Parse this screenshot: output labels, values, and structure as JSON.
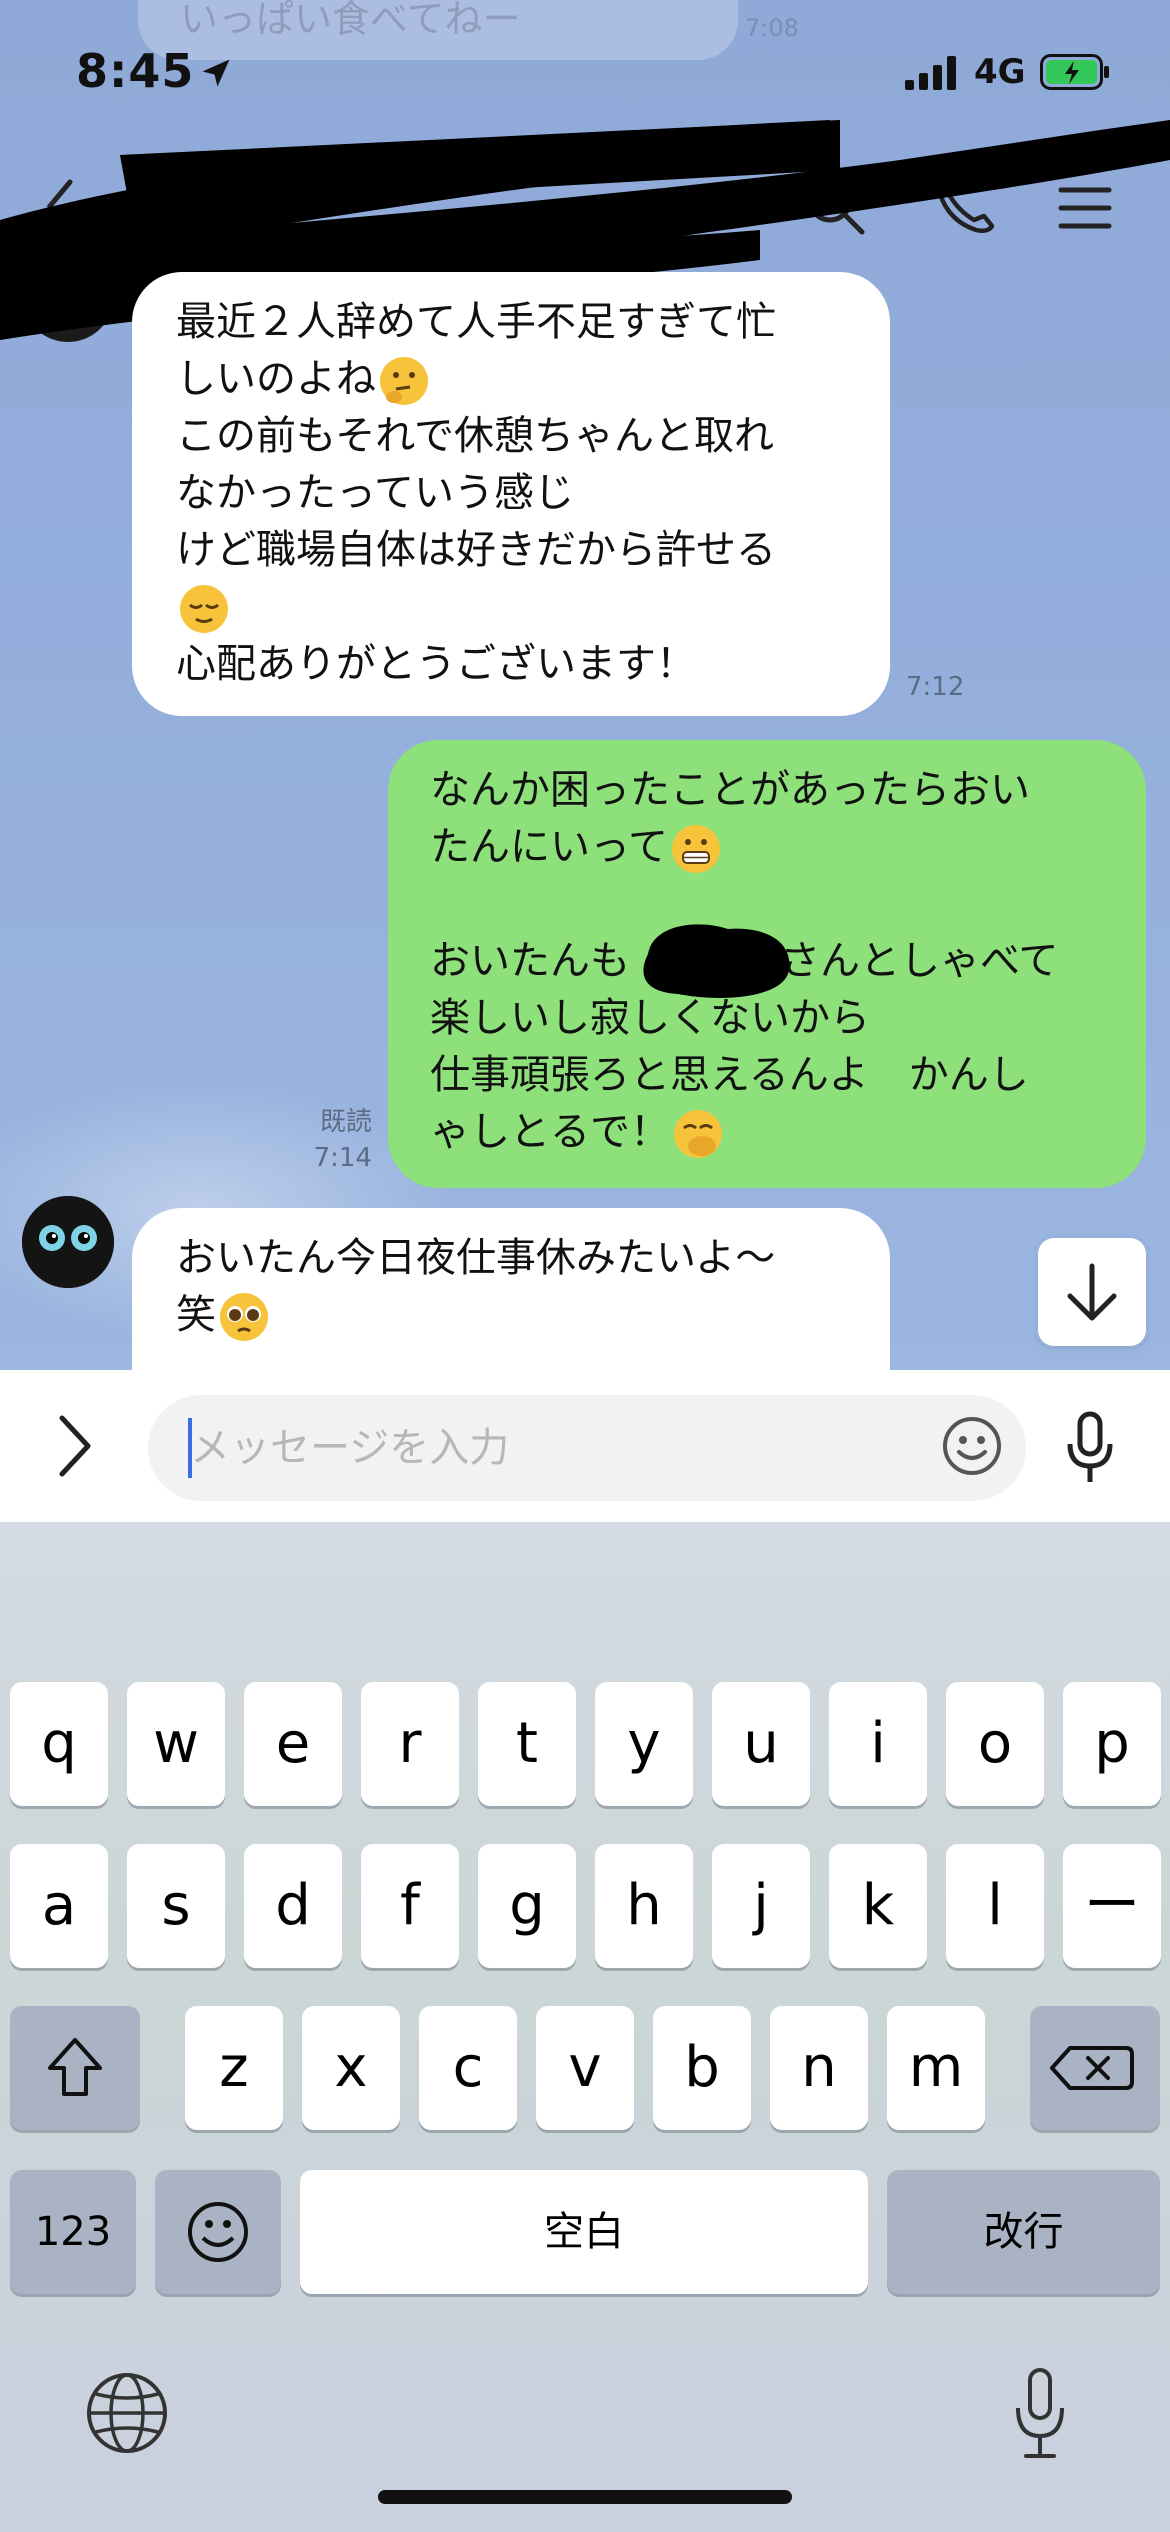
{
  "status_bar": {
    "time": "8:45",
    "network": "4G"
  },
  "ghost": {
    "text": "いっぱい食べてねー",
    "time": "7:08"
  },
  "header": {
    "title_redacted": true
  },
  "messages": [
    {
      "side": "in",
      "lines": [
        "最近２人辞めて人手不足すぎて忙",
        "しいのよね",
        "この前もそれで休憩ちゃんと取れ",
        "なかったっていう感じ",
        "けど職場自体は好きだから許せる",
        "",
        "心配ありがとうございます！"
      ],
      "time": "7:12"
    },
    {
      "side": "out",
      "lines": [
        "なんか困ったことがあったらおい",
        "たんにいって",
        "",
        "おいたんも",
        "さんとしゃべて",
        "楽しいし寂しくないから",
        "仕事頑張ろと思えるんよ　かんし",
        "ゃしとるで！"
      ],
      "read": "既読",
      "time": "7:14"
    },
    {
      "side": "in",
      "lines": [
        "おいたん今日夜仕事休みたいよ〜",
        "笑"
      ]
    }
  ],
  "input": {
    "placeholder": "メッセージを入力"
  },
  "keyboard": {
    "row1": [
      "q",
      "w",
      "e",
      "r",
      "t",
      "y",
      "u",
      "i",
      "o",
      "p"
    ],
    "row2": [
      "a",
      "s",
      "d",
      "f",
      "g",
      "h",
      "j",
      "k",
      "l",
      "ー"
    ],
    "row3": [
      "z",
      "x",
      "c",
      "v",
      "b",
      "n",
      "m"
    ],
    "numbers": "123",
    "space": "空白",
    "return": "改行"
  },
  "colors": {
    "outgoing": "#8ee07b",
    "incoming": "#ffffff",
    "chat_bg": "#93aedc"
  }
}
